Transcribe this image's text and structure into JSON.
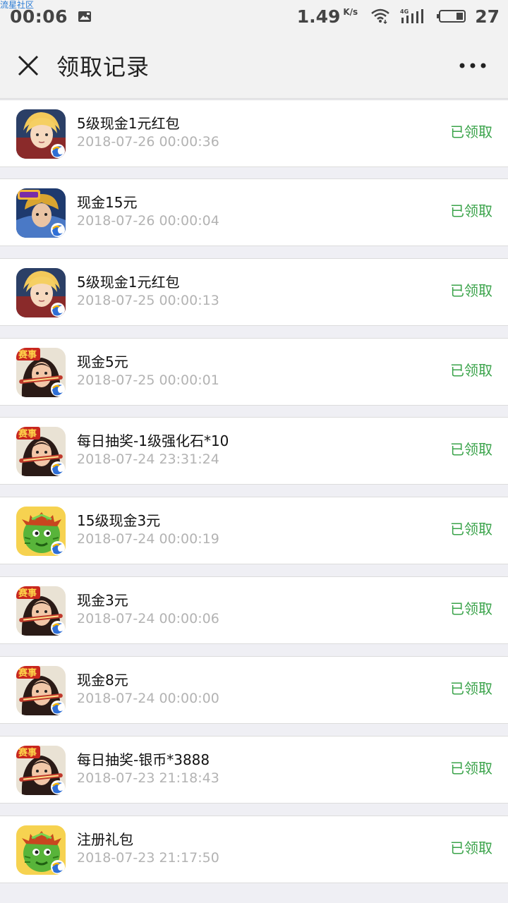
{
  "watermark": "流星社区",
  "statusbar": {
    "time": "00:06",
    "speed": "1.49",
    "speed_unit": "K/s",
    "signal_label": "4G",
    "battery": "27"
  },
  "header": {
    "title": "领取记录"
  },
  "records": [
    {
      "title": "5级现金1元红包",
      "time": "2018-07-26 00:00:36",
      "status": "已领取",
      "icon": "hero-blonde-icon"
    },
    {
      "title": "现金15元",
      "time": "2018-07-26 00:00:04",
      "status": "已领取",
      "icon": "hero-armored-icon"
    },
    {
      "title": "5级现金1元红包",
      "time": "2018-07-25 00:00:13",
      "status": "已领取",
      "icon": "hero-blonde-icon"
    },
    {
      "title": "现金5元",
      "time": "2018-07-25 00:00:01",
      "status": "已领取",
      "icon": "warrior-girl-icon"
    },
    {
      "title": "每日抽奖-1级强化石*10",
      "time": "2018-07-24 23:31:24",
      "status": "已领取",
      "icon": "warrior-girl-icon"
    },
    {
      "title": "15级现金3元",
      "time": "2018-07-24 00:00:19",
      "status": "已领取",
      "icon": "green-cactus-icon"
    },
    {
      "title": "现金3元",
      "time": "2018-07-24 00:00:06",
      "status": "已领取",
      "icon": "warrior-girl-icon"
    },
    {
      "title": "现金8元",
      "time": "2018-07-24 00:00:00",
      "status": "已领取",
      "icon": "warrior-girl-icon"
    },
    {
      "title": "每日抽奖-银币*3888",
      "time": "2018-07-23 21:18:43",
      "status": "已领取",
      "icon": "warrior-girl-icon"
    },
    {
      "title": "注册礼包",
      "time": "2018-07-23 21:17:50",
      "status": "已领取",
      "icon": "green-cactus-icon"
    }
  ]
}
